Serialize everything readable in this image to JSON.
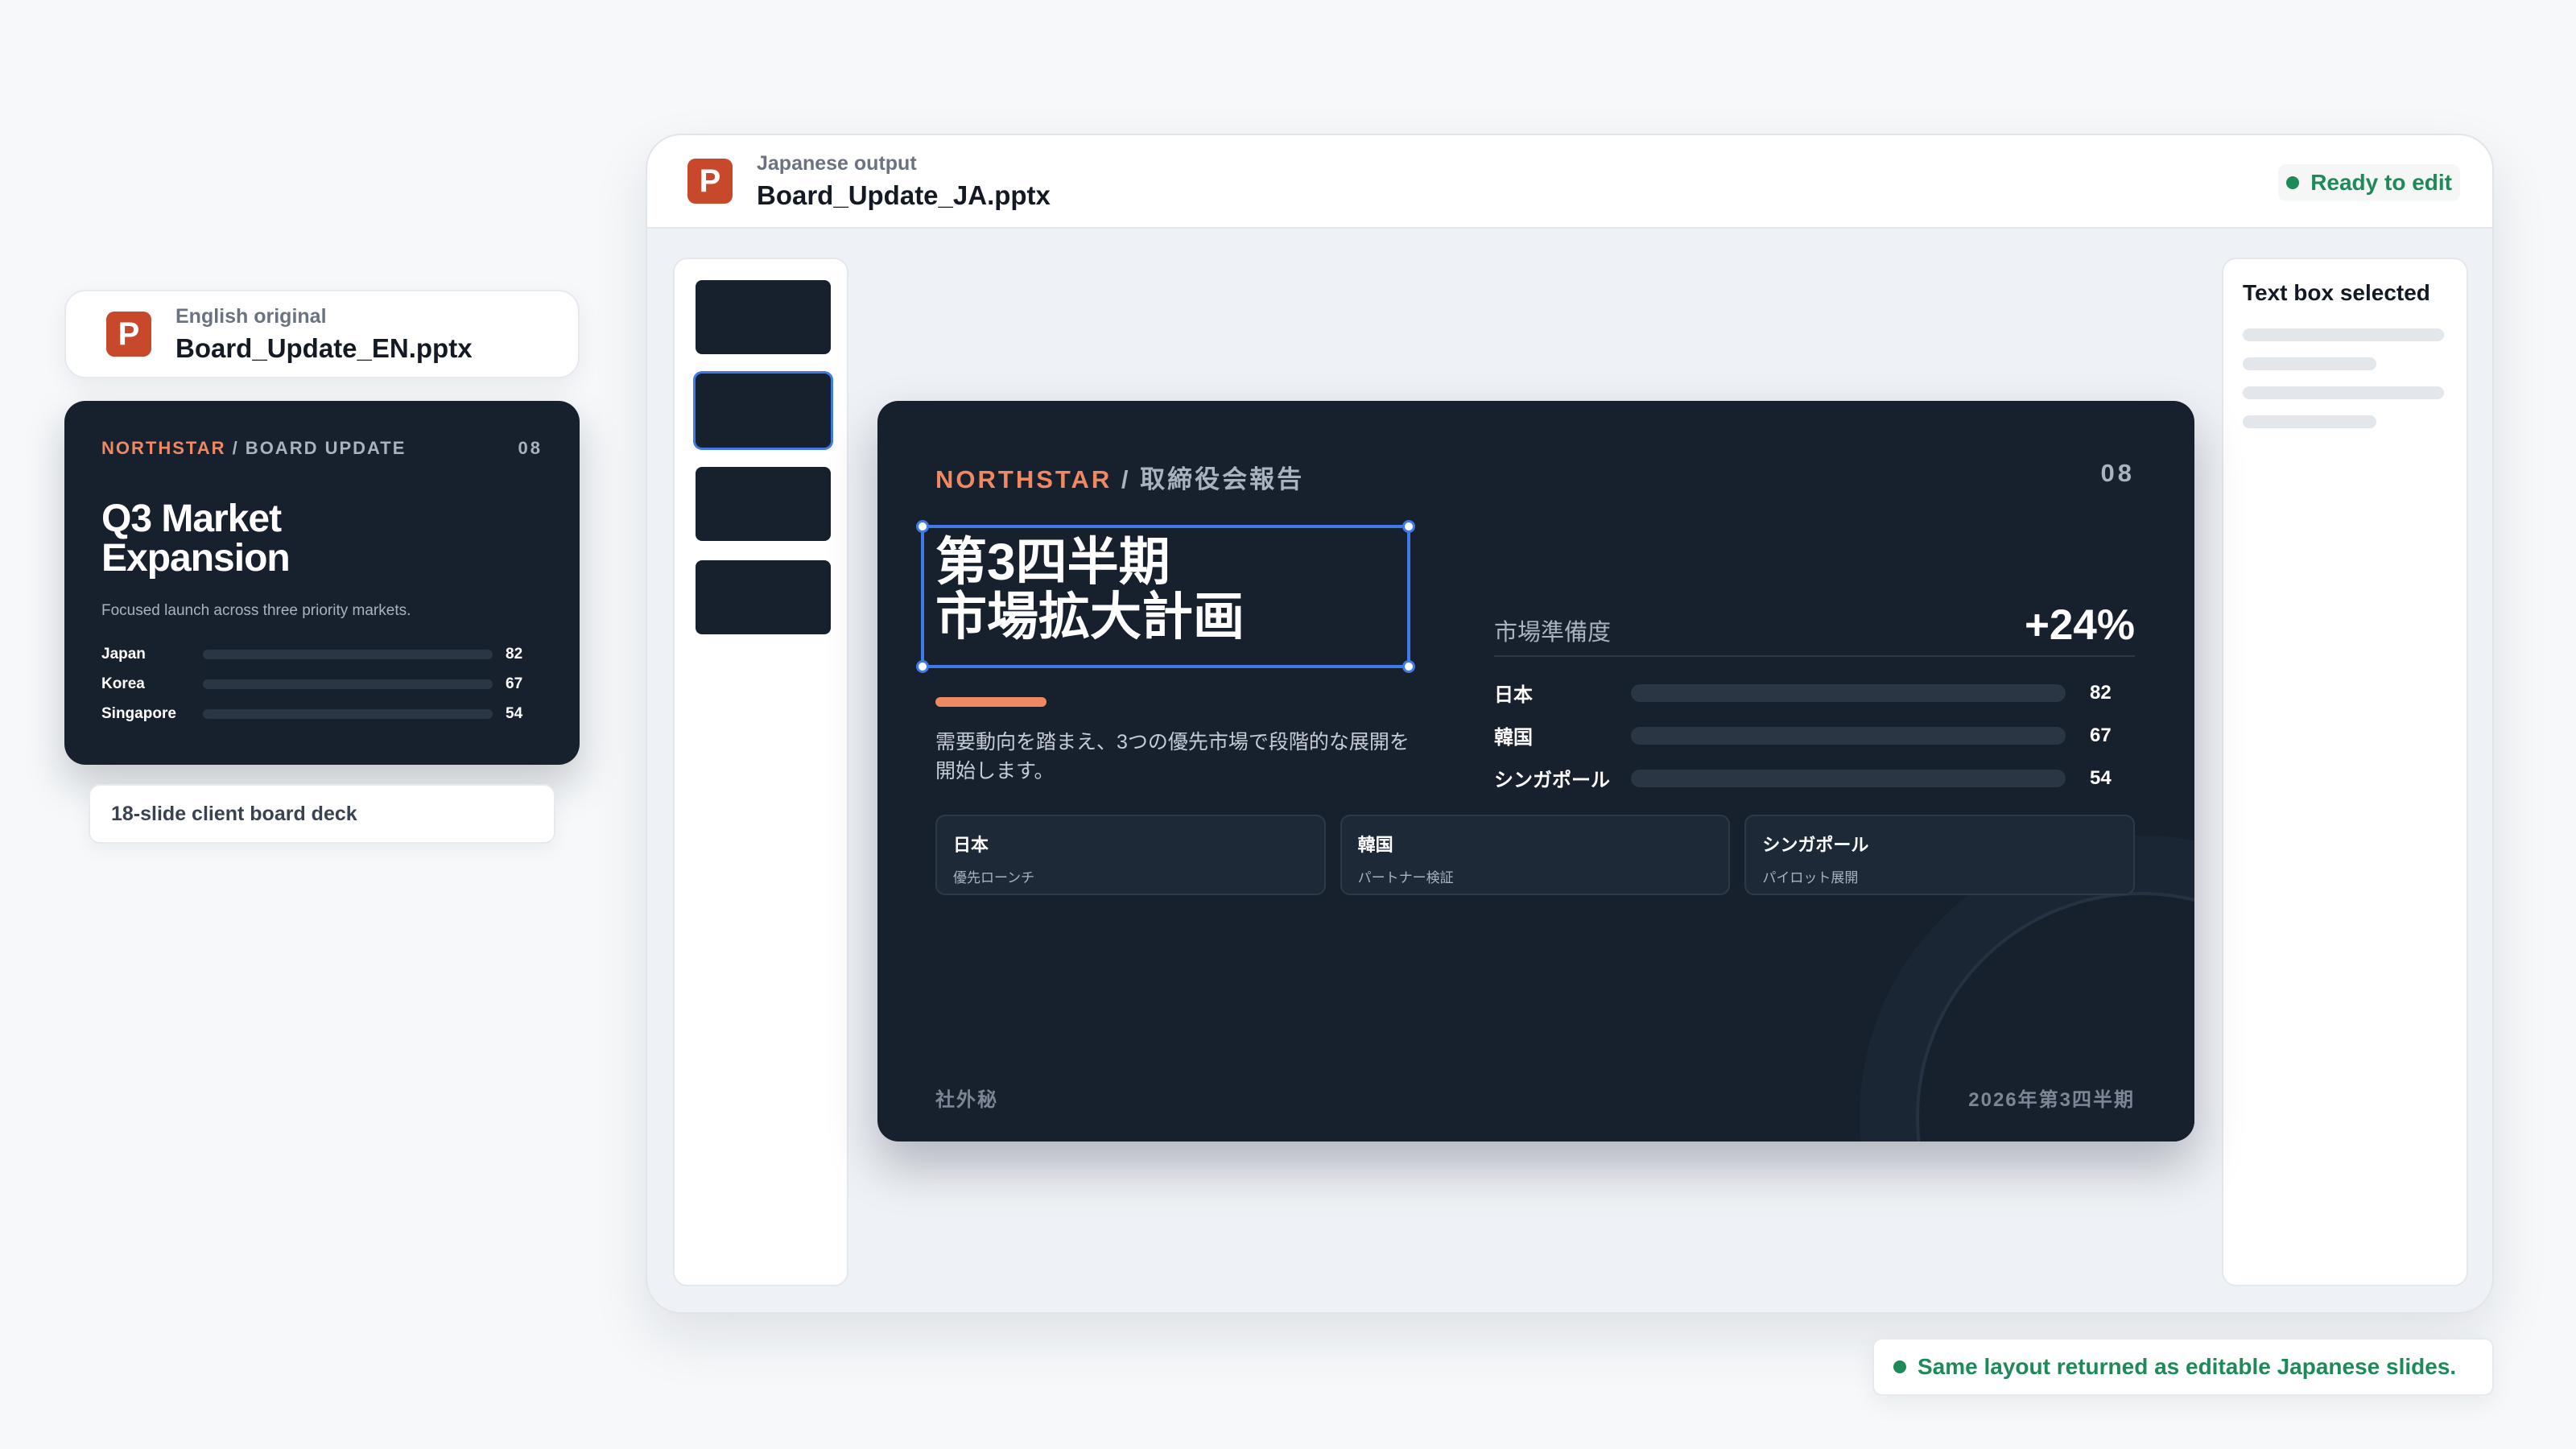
{
  "english": {
    "file_sub": "English original",
    "file_name": "Board_Update_EN.pptx",
    "icon_letter": "P",
    "slide": {
      "brand": "NORTHSTAR",
      "brand_rest": " / BOARD UPDATE",
      "number": "08",
      "title": "Q3 Market Expansion",
      "desc": "Focused launch across three priority markets.",
      "bars": [
        {
          "label": "Japan",
          "value": 82
        },
        {
          "label": "Korea",
          "value": 67
        },
        {
          "label": "Singapore",
          "value": 54
        }
      ]
    },
    "deck_label": "18-slide client board deck"
  },
  "window": {
    "file_sub": "Japanese output",
    "file_name": "Board_Update_JA.pptx",
    "icon_letter": "P",
    "status": "Ready to edit",
    "active_thumb": 2,
    "thumb_count": 4
  },
  "props": {
    "title": "Text box selected"
  },
  "japanese_slide": {
    "brand": "NORTHSTAR",
    "brand_rest": " / 取締役会報告",
    "number": "08",
    "title": "第3四半期\n市場拡大計画",
    "desc": "需要動向を踏まえ、3つの優先市場で段階的な展開を開始します。",
    "metric_label": "市場準備度",
    "metric_value": "+24%",
    "bars": [
      {
        "label": "日本",
        "value": 82
      },
      {
        "label": "韓国",
        "value": 67
      },
      {
        "label": "シンガポール",
        "value": 54
      }
    ],
    "cards": [
      {
        "title": "日本",
        "sub": "優先ローンチ"
      },
      {
        "title": "韓国",
        "sub": "パートナー検証"
      },
      {
        "title": "シンガポール",
        "sub": "パイロット展開"
      }
    ],
    "footer_left": "社外秘",
    "footer_right": "2026年第3四半期"
  },
  "bottom_note": "Same layout returned as editable Japanese slides.",
  "colors": {
    "brand_orange": "#f08862",
    "bar_teal": "#5fb0b3",
    "slide_bg": "#17212e",
    "status_green": "#1e8a5a",
    "selection_blue": "#3f7ae8",
    "ppt_red": "#c8482b"
  }
}
